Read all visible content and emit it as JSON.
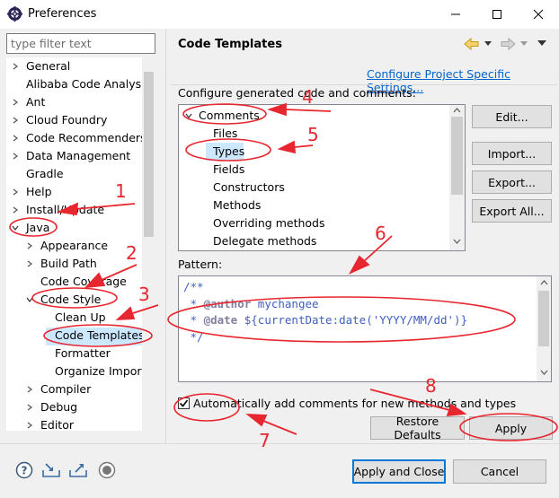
{
  "window": {
    "title": "Preferences",
    "controls": {
      "minimize": "min-icon",
      "maximize": "max-icon",
      "close": "close-icon"
    }
  },
  "sidebar": {
    "filter_placeholder": "type filter text",
    "items": [
      {
        "label": "General",
        "twisty": "collapsed"
      },
      {
        "label": "Alibaba Code Analysis",
        "twisty": "none"
      },
      {
        "label": "Ant",
        "twisty": "collapsed"
      },
      {
        "label": "Cloud Foundry",
        "twisty": "collapsed"
      },
      {
        "label": "Code Recommenders",
        "twisty": "collapsed"
      },
      {
        "label": "Data Management",
        "twisty": "collapsed"
      },
      {
        "label": "Gradle",
        "twisty": "none"
      },
      {
        "label": "Help",
        "twisty": "collapsed"
      },
      {
        "label": "Install/Update",
        "twisty": "collapsed"
      },
      {
        "label": "Java",
        "twisty": "expanded"
      },
      {
        "label": "Appearance",
        "twisty": "collapsed"
      },
      {
        "label": "Build Path",
        "twisty": "collapsed"
      },
      {
        "label": "Code Coverage",
        "twisty": "none"
      },
      {
        "label": "Code Style",
        "twisty": "expanded"
      },
      {
        "label": "Clean Up",
        "twisty": "none"
      },
      {
        "label": "Code Templates",
        "twisty": "none",
        "selected": true
      },
      {
        "label": "Formatter",
        "twisty": "none"
      },
      {
        "label": "Organize Imports",
        "twisty": "none"
      },
      {
        "label": "Compiler",
        "twisty": "collapsed"
      },
      {
        "label": "Debug",
        "twisty": "collapsed"
      },
      {
        "label": "Editor",
        "twisty": "collapsed"
      }
    ]
  },
  "main": {
    "title": "Code Templates",
    "configure_link": "Configure Project Specific Settings...",
    "section_label": "Configure generated code and comments:",
    "templates": [
      {
        "label": "Comments",
        "twisty": "expanded"
      },
      {
        "label": "Files"
      },
      {
        "label": "Types",
        "selected": true
      },
      {
        "label": "Fields"
      },
      {
        "label": "Constructors"
      },
      {
        "label": "Methods"
      },
      {
        "label": "Overriding methods"
      },
      {
        "label": "Delegate methods"
      }
    ],
    "buttons": {
      "edit": "Edit...",
      "import": "Import...",
      "export": "Export...",
      "export_all": "Export All..."
    },
    "pattern_label": "Pattern:",
    "pattern": {
      "line1": "/**",
      "line2_prefix": " * ",
      "line2_tag": "@author",
      "line2_value": " mychangee",
      "line3_prefix": " * ",
      "line3_tag": "@date",
      "line3_value": " ${currentDate:date('YYYY/MM/dd')}",
      "line4": " */"
    },
    "auto_comments_label": "Automatically add comments for new methods and types",
    "auto_comments_checked": true,
    "restore_defaults": "Restore Defaults",
    "apply": "Apply"
  },
  "footer": {
    "icons": [
      "help-icon",
      "import-prefs-icon",
      "export-prefs-icon",
      "record-icon"
    ],
    "apply_and_close": "Apply and Close",
    "cancel": "Cancel"
  },
  "annotations": [
    "1",
    "2",
    "3",
    "4",
    "5",
    "6",
    "7",
    "8"
  ],
  "colors": {
    "accent": "#0078d7",
    "selection": "#cce8ff",
    "link": "#0066cc",
    "markup": "#e8262f"
  }
}
